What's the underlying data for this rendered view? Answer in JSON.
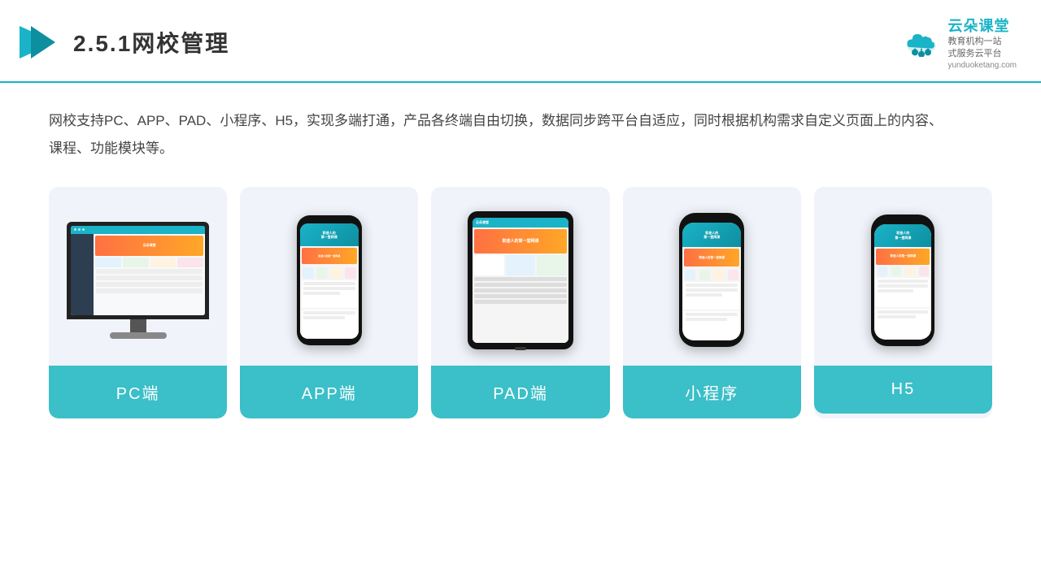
{
  "header": {
    "section_number": "2.5.1",
    "title": "网校管理",
    "brand": {
      "name": "云朵课堂",
      "url": "yunduoketang.com",
      "slogan": "教育机构一站\n式服务云平台"
    }
  },
  "description": "网校支持PC、APP、PAD、小程序、H5，实现多端打通，产品各终端自由切换，数据同步跨平台自适应，同时根据机构需求自定义页面上的内容、课程、功能模块等。",
  "cards": [
    {
      "id": "pc",
      "label": "PC端",
      "device_type": "monitor"
    },
    {
      "id": "app",
      "label": "APP端",
      "device_type": "phone"
    },
    {
      "id": "pad",
      "label": "PAD端",
      "device_type": "tablet"
    },
    {
      "id": "miniprogram",
      "label": "小程序",
      "device_type": "notch_phone"
    },
    {
      "id": "h5",
      "label": "H5",
      "device_type": "h5_phone"
    }
  ],
  "colors": {
    "primary": "#1ab3c8",
    "card_label_bg": "#3bbfc8",
    "card_bg": "#f0f4fa"
  }
}
